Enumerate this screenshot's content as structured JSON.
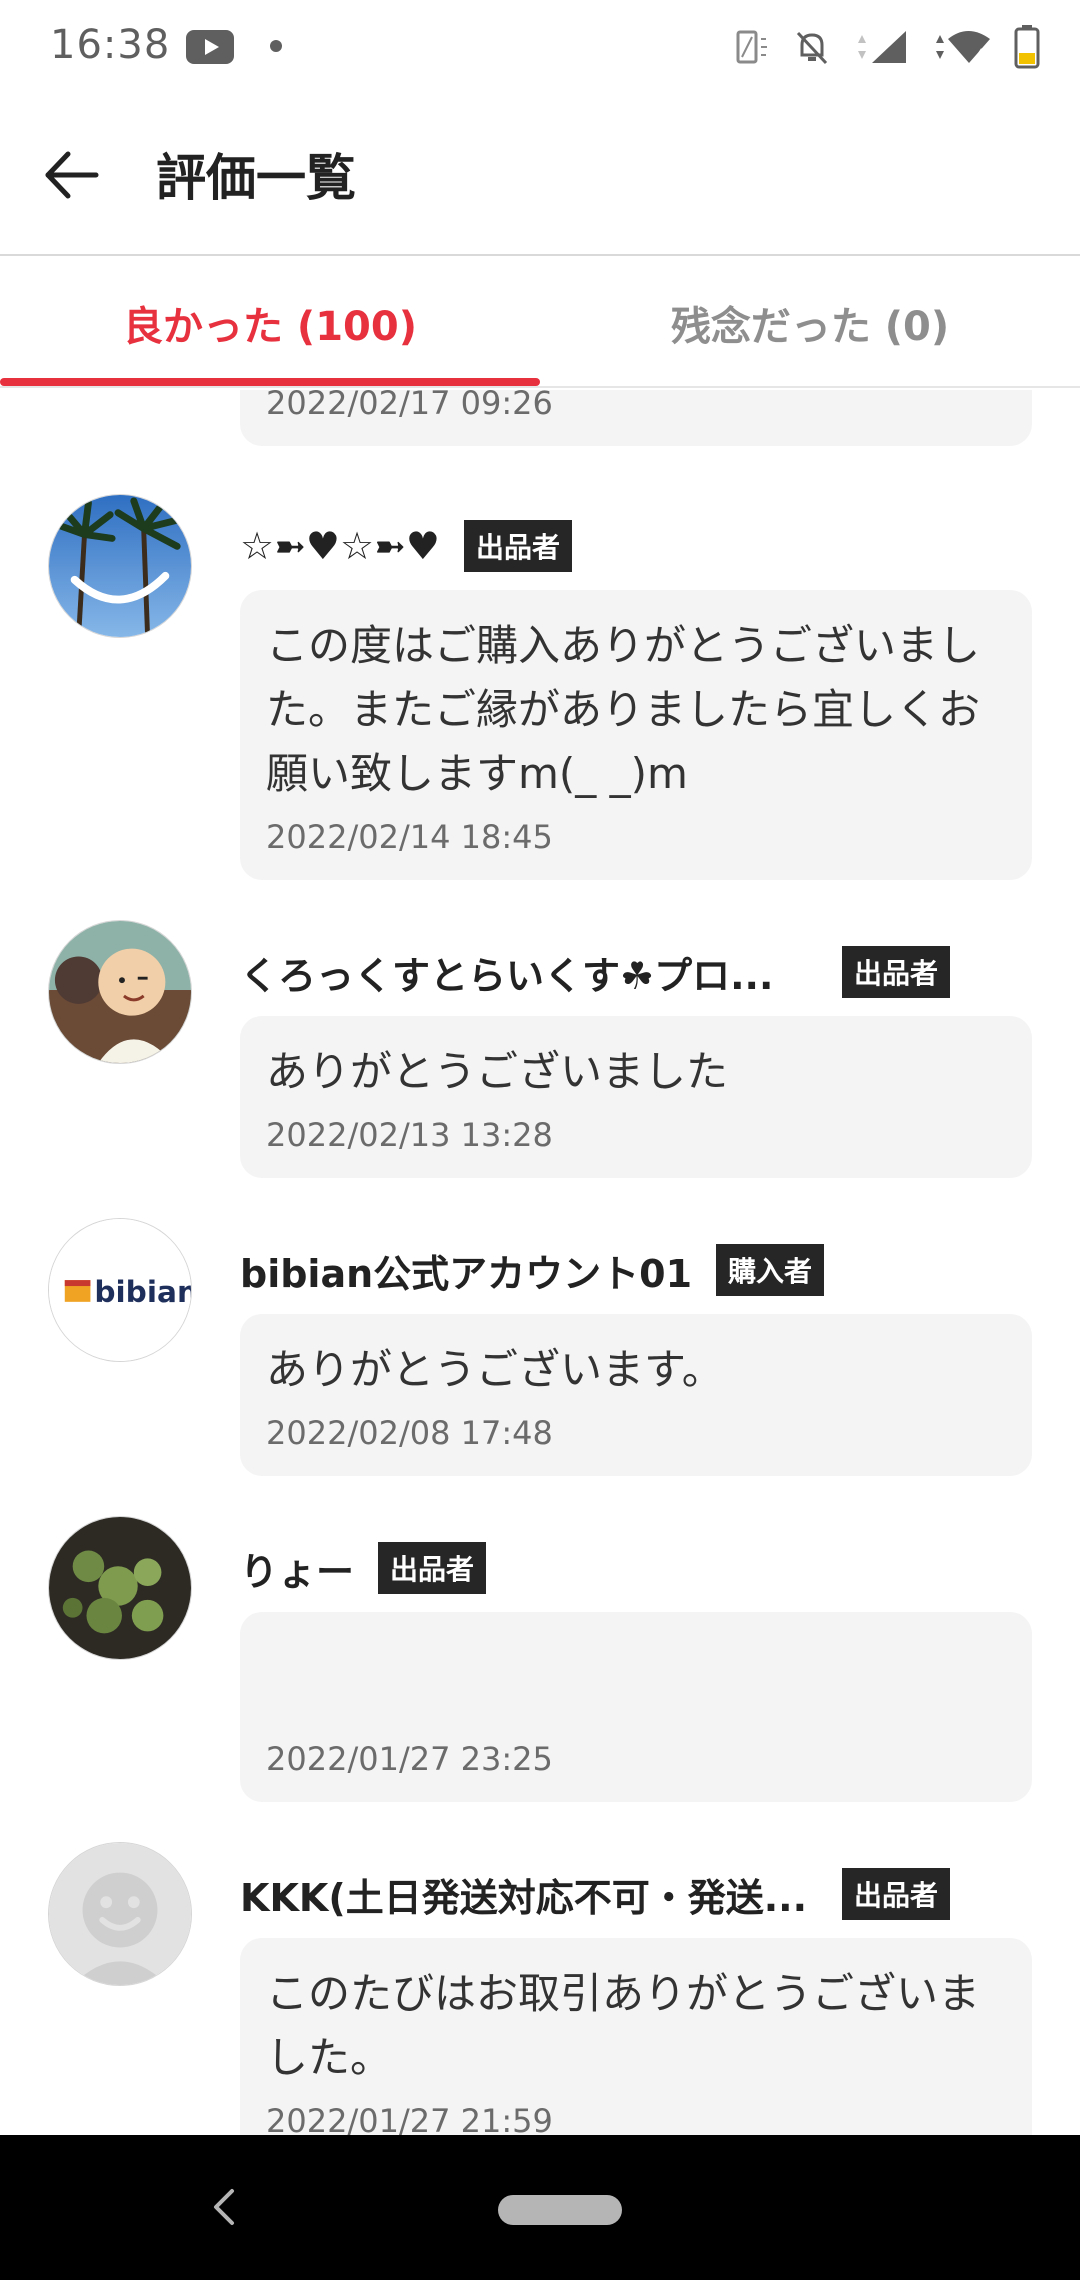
{
  "status_bar": {
    "time": "16:38",
    "icons": [
      "youtube-icon",
      "notification-dot",
      "vibrate-icon",
      "notifications-off-icon",
      "cell-signal-icon",
      "wifi-icon",
      "battery-icon"
    ],
    "wifi_badge": "4"
  },
  "header": {
    "title": "評価一覧",
    "back_icon": "arrow-left-icon"
  },
  "tabs": [
    {
      "label": "良かった (100)",
      "active": true
    },
    {
      "label": "残念だった (0)",
      "active": false
    }
  ],
  "colors": {
    "accent": "#e8313f",
    "badge_bg": "#262626",
    "bubble_bg": "#f4f4f4"
  },
  "reviews": [
    {
      "name": "",
      "role": "",
      "comment": "",
      "timestamp": "2022/02/17 09:26"
    },
    {
      "name": "☆➼♥☆➼♥",
      "role": "出品者",
      "comment": "この度はご購入ありがとうございました。またご縁がありましたら宜しくお願い致しますm(_ _)m",
      "timestamp": "2022/02/14 18:45",
      "avatar": "palm-trees-smile-avatar"
    },
    {
      "name": "くろっくすとらいくす☘プロ...",
      "role": "出品者",
      "comment": "ありがとうございました",
      "timestamp": "2022/02/13 13:28",
      "avatar": "cartoon-monk-avatar"
    },
    {
      "name": "bibian公式アカウント01",
      "role": "購入者",
      "comment": "ありがとうございます。",
      "timestamp": "2022/02/08 17:48",
      "avatar": "bibian-logo-avatar",
      "avatar_text": "bibian"
    },
    {
      "name": "りょー",
      "role": "出品者",
      "comment": "",
      "timestamp": "2022/01/27 23:25",
      "avatar": "plant-photo-avatar"
    },
    {
      "name": "KKK(土日発送対応不可・発送...",
      "role": "出品者",
      "comment": "このたびはお取引ありがとうございました。",
      "timestamp": "2022/01/27 21:59",
      "avatar": "default-smiley-avatar"
    }
  ],
  "nav_bar": {
    "back_icon": "nav-back-icon",
    "home_icon": "nav-home-pill"
  }
}
